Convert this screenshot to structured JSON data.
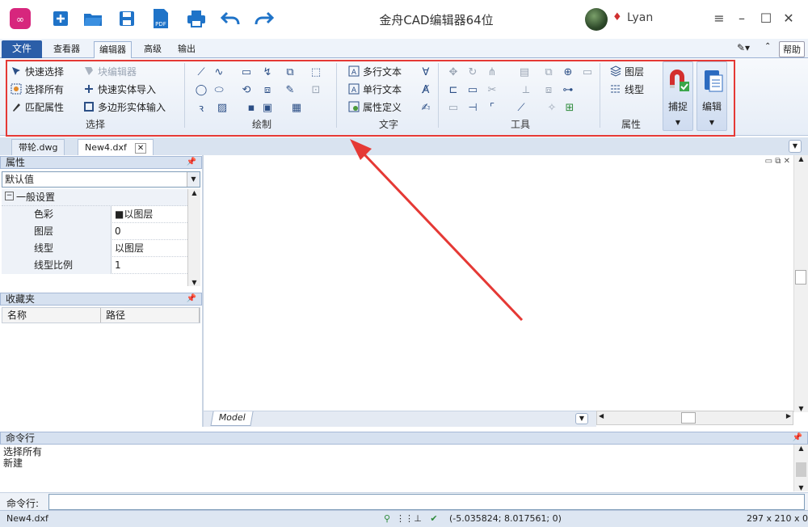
{
  "titlebar": {
    "title": "金舟CAD编辑器64位",
    "username": "Lyan",
    "quick_icons": [
      "app-logo-icon",
      "new-icon",
      "open-icon",
      "save-icon",
      "pdf-icon",
      "print-icon",
      "undo-icon",
      "redo-icon"
    ],
    "pdf_icon_text": "PDF",
    "window_buttons": [
      "≡",
      "–",
      "☐",
      "✕"
    ]
  },
  "ribbon_tabs": [
    "文件",
    "查看器",
    "编辑器",
    "高级",
    "输出"
  ],
  "help_label": "帮助",
  "ribbon": {
    "select": {
      "label": "选择",
      "items": [
        "快速选择",
        "选择所有",
        "匹配属性",
        "块编辑器",
        "快速实体导入",
        "多边形实体输入"
      ]
    },
    "draw": {
      "label": "绘制"
    },
    "text": {
      "label": "文字",
      "items": [
        "多行文本",
        "单行文本",
        "属性定义"
      ]
    },
    "tools": {
      "label": "工具"
    },
    "props": {
      "label": "属性",
      "items": [
        "图层",
        "线型"
      ]
    },
    "snap_label": "捕捉",
    "edit_label": "编辑"
  },
  "doc_tabs": [
    "带轮.dwg",
    "New4.dxf"
  ],
  "properties_panel": {
    "title": "属性",
    "selected": "默认值",
    "section": "一般设置",
    "rows": [
      {
        "name": "色彩",
        "value": "■以图层"
      },
      {
        "name": "图层",
        "value": "0"
      },
      {
        "name": "线型",
        "value": "以图层"
      },
      {
        "name": "线型比例",
        "value": "1"
      }
    ]
  },
  "favorites_panel": {
    "title": "收藏夹",
    "columns": [
      "名称",
      "路径"
    ]
  },
  "model_tab": "Model",
  "command_panel": {
    "title": "命令行",
    "history": [
      "选择所有",
      "新建"
    ],
    "prompt": "命令行:"
  },
  "status": {
    "file": "New4.dxf",
    "coords": "(-5.035824; 8.017561; 0)",
    "paper": "297 x 210 x 0"
  },
  "colors": {
    "accent": "#2b5ea8",
    "highlight": "#e53935"
  }
}
